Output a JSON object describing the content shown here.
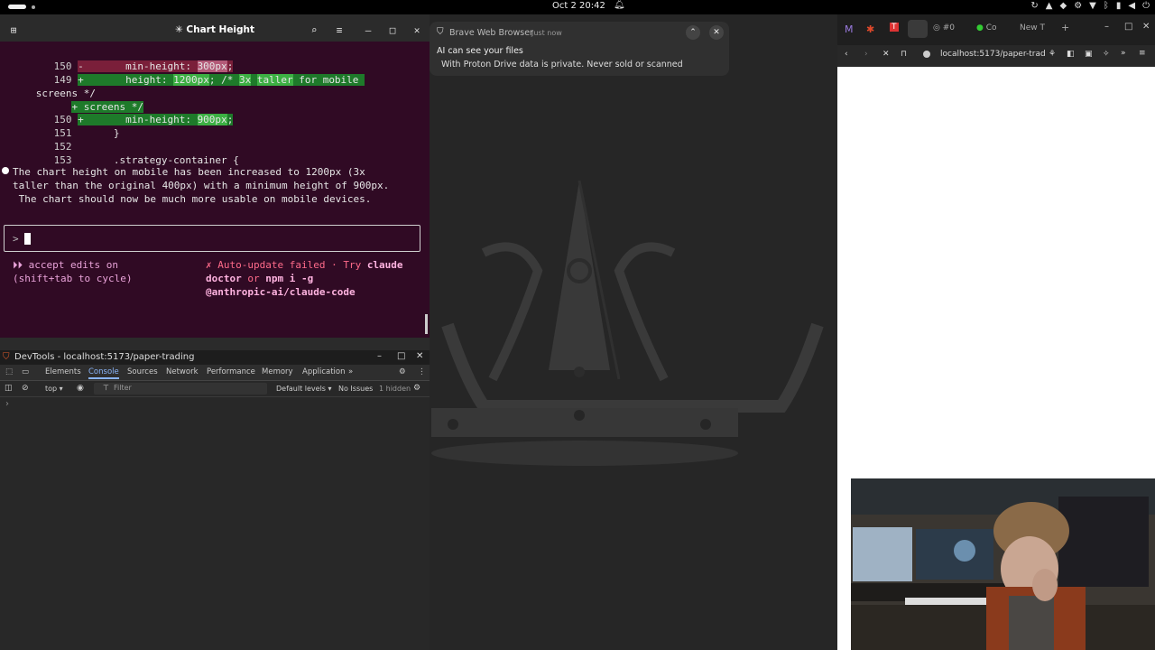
{
  "system_bar": {
    "clock": "Oct 2  20:42"
  },
  "terminal": {
    "title": "✳ Chart Height",
    "diff_lines": [
      {
        "num": "150",
        "sign": "-",
        "text": "        min-height: 300px;"
      },
      {
        "num": "149",
        "sign": "+",
        "text": "        height: 1200px; /* 3x taller for mobile"
      },
      {
        "num": "",
        "sign": "",
        "text": "screens */"
      },
      {
        "num": "",
        "sign": "+",
        "text": " screens */"
      },
      {
        "num": "150",
        "sign": "+",
        "text": "        min-height: 900px;"
      },
      {
        "num": "151",
        "sign": "",
        "text": "      }"
      },
      {
        "num": "152",
        "sign": "",
        "text": ""
      },
      {
        "num": "153",
        "sign": "",
        "text": "      .strategy-container {"
      }
    ],
    "message_line1": "The chart height on mobile has been increased to 1200px (3x",
    "message_line2": "taller than the original 400px) with a minimum height of 900px.",
    "message_line3": " The chart should now be much more usable on mobile devices.",
    "prompt_symbol": ">",
    "accept_edits_line1": "⏵⏵ accept edits on",
    "accept_edits_line2": "(shift+tab to cycle)",
    "autoupdate_line1_a": "✗ Auto-update failed · Try ",
    "autoupdate_line1_b": "claude",
    "autoupdate_line2_a": "doctor",
    "autoupdate_line2_b": " or ",
    "autoupdate_line2_c": "npm i -g",
    "autoupdate_line3": "@anthropic-ai/claude-code"
  },
  "notification": {
    "app": "Brave Web Browser",
    "time": "Just now",
    "title": "AI can see your files",
    "body": "With Proton Drive data is private. Never sold or scanned"
  },
  "devtools": {
    "title": "DevTools - localhost:5173/paper-trading",
    "tabs": [
      "Elements",
      "Console",
      "Sources",
      "Network",
      "Performance",
      "Memory",
      "Application"
    ],
    "active_tab": "Console",
    "context": "top",
    "filter_placeholder": "Filter",
    "levels": "Default levels",
    "issues": "No Issues",
    "hidden": "1 hidden",
    "console_caret": "›"
  },
  "browser": {
    "tabs": [
      "#0",
      "Co",
      "New T"
    ],
    "url": "localhost:5173/paper-trad"
  },
  "colors": {
    "terminal_bg": "#300a24",
    "diff_removed": "#7a1f3a",
    "diff_added": "#1e7a2a",
    "devtools_active_tab": "#8ab4f8"
  }
}
